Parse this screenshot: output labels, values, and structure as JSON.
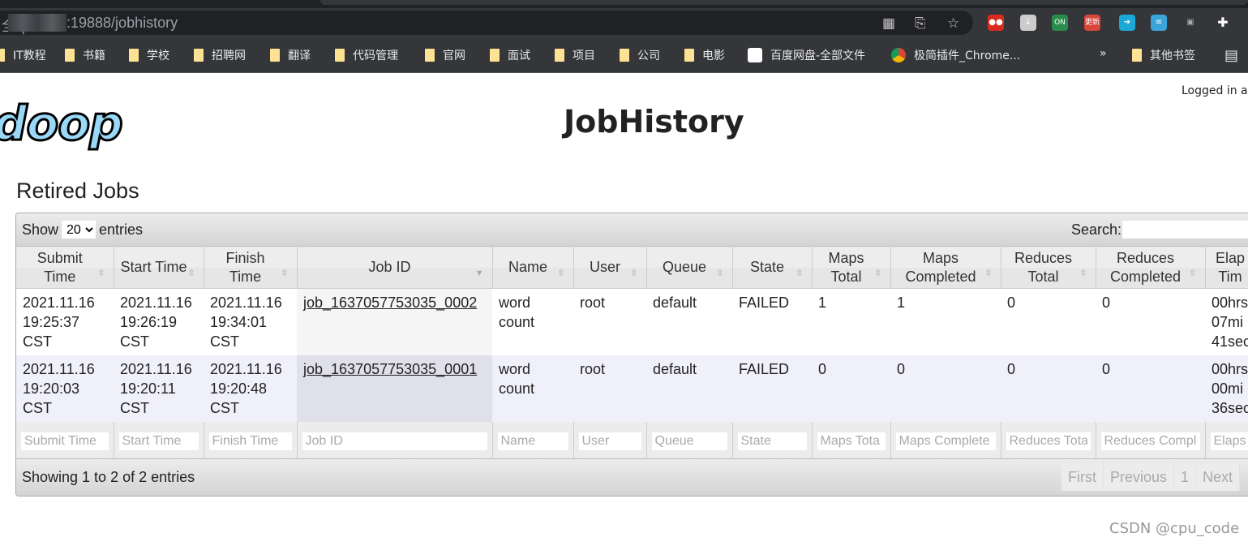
{
  "browser": {
    "url_prefix": "全 |",
    "url": ":19888/jobhistory",
    "bookmarks": [
      "IT教程",
      "书籍",
      "学校",
      "招聘网",
      "翻译",
      "代码管理",
      "官网",
      "面试",
      "项目",
      "公司",
      "电影",
      "百度网盘-全部文件",
      "极简插件_Chrome..."
    ],
    "overflow": "»",
    "other_bookmarks": "其他书签",
    "ext_badges": [
      "ON",
      "更新"
    ]
  },
  "header": {
    "logo": "doop",
    "title": "JobHistory",
    "login": "Logged in a"
  },
  "section_title": "Retired Jobs",
  "table_controls": {
    "show": "Show",
    "length": "20",
    "entries": "entries",
    "search_label": "Search:",
    "search_value": ""
  },
  "columns": [
    {
      "l1": "Submit",
      "l2": "Time"
    },
    {
      "l1": "Start Time",
      "l2": ""
    },
    {
      "l1": "Finish",
      "l2": "Time"
    },
    {
      "l1": "Job ID",
      "l2": ""
    },
    {
      "l1": "Name",
      "l2": ""
    },
    {
      "l1": "User",
      "l2": ""
    },
    {
      "l1": "Queue",
      "l2": ""
    },
    {
      "l1": "State",
      "l2": ""
    },
    {
      "l1": "Maps",
      "l2": "Total"
    },
    {
      "l1": "Maps",
      "l2": "Completed"
    },
    {
      "l1": "Reduces",
      "l2": "Total"
    },
    {
      "l1": "Reduces",
      "l2": "Completed"
    },
    {
      "l1": "Elap",
      "l2": "Tim"
    }
  ],
  "rows": [
    {
      "submit": "2021.11.16 19:25:37 CST",
      "start": "2021.11.16 19:26:19 CST",
      "finish": "2021.11.16 19:34:01 CST",
      "job_id": "job_1637057753035_0002",
      "name": "word count",
      "user": "root",
      "queue": "default",
      "state": "FAILED",
      "maps_total": "1",
      "maps_completed": "1",
      "reduces_total": "0",
      "reduces_completed": "0",
      "elapsed": "00hrs 07mi 41sec"
    },
    {
      "submit": "2021.11.16 19:20:03 CST",
      "start": "2021.11.16 19:20:11 CST",
      "finish": "2021.11.16 19:20:48 CST",
      "job_id": "job_1637057753035_0001",
      "name": "word count",
      "user": "root",
      "queue": "default",
      "state": "FAILED",
      "maps_total": "0",
      "maps_completed": "0",
      "reduces_total": "0",
      "reduces_completed": "0",
      "elapsed": "00hrs 00mi 36sec"
    }
  ],
  "filters": [
    "Submit Time",
    "Start Time",
    "Finish Time",
    "Job ID",
    "Name",
    "User",
    "Queue",
    "State",
    "Maps Tota",
    "Maps Complete",
    "Reduces Tota",
    "Reduces Compl",
    "Elaps"
  ],
  "footer": {
    "info": "Showing 1 to 2 of 2 entries",
    "first": "First",
    "previous": "Previous",
    "page": "1",
    "next": "Next"
  },
  "watermark": "CSDN @cpu_code"
}
